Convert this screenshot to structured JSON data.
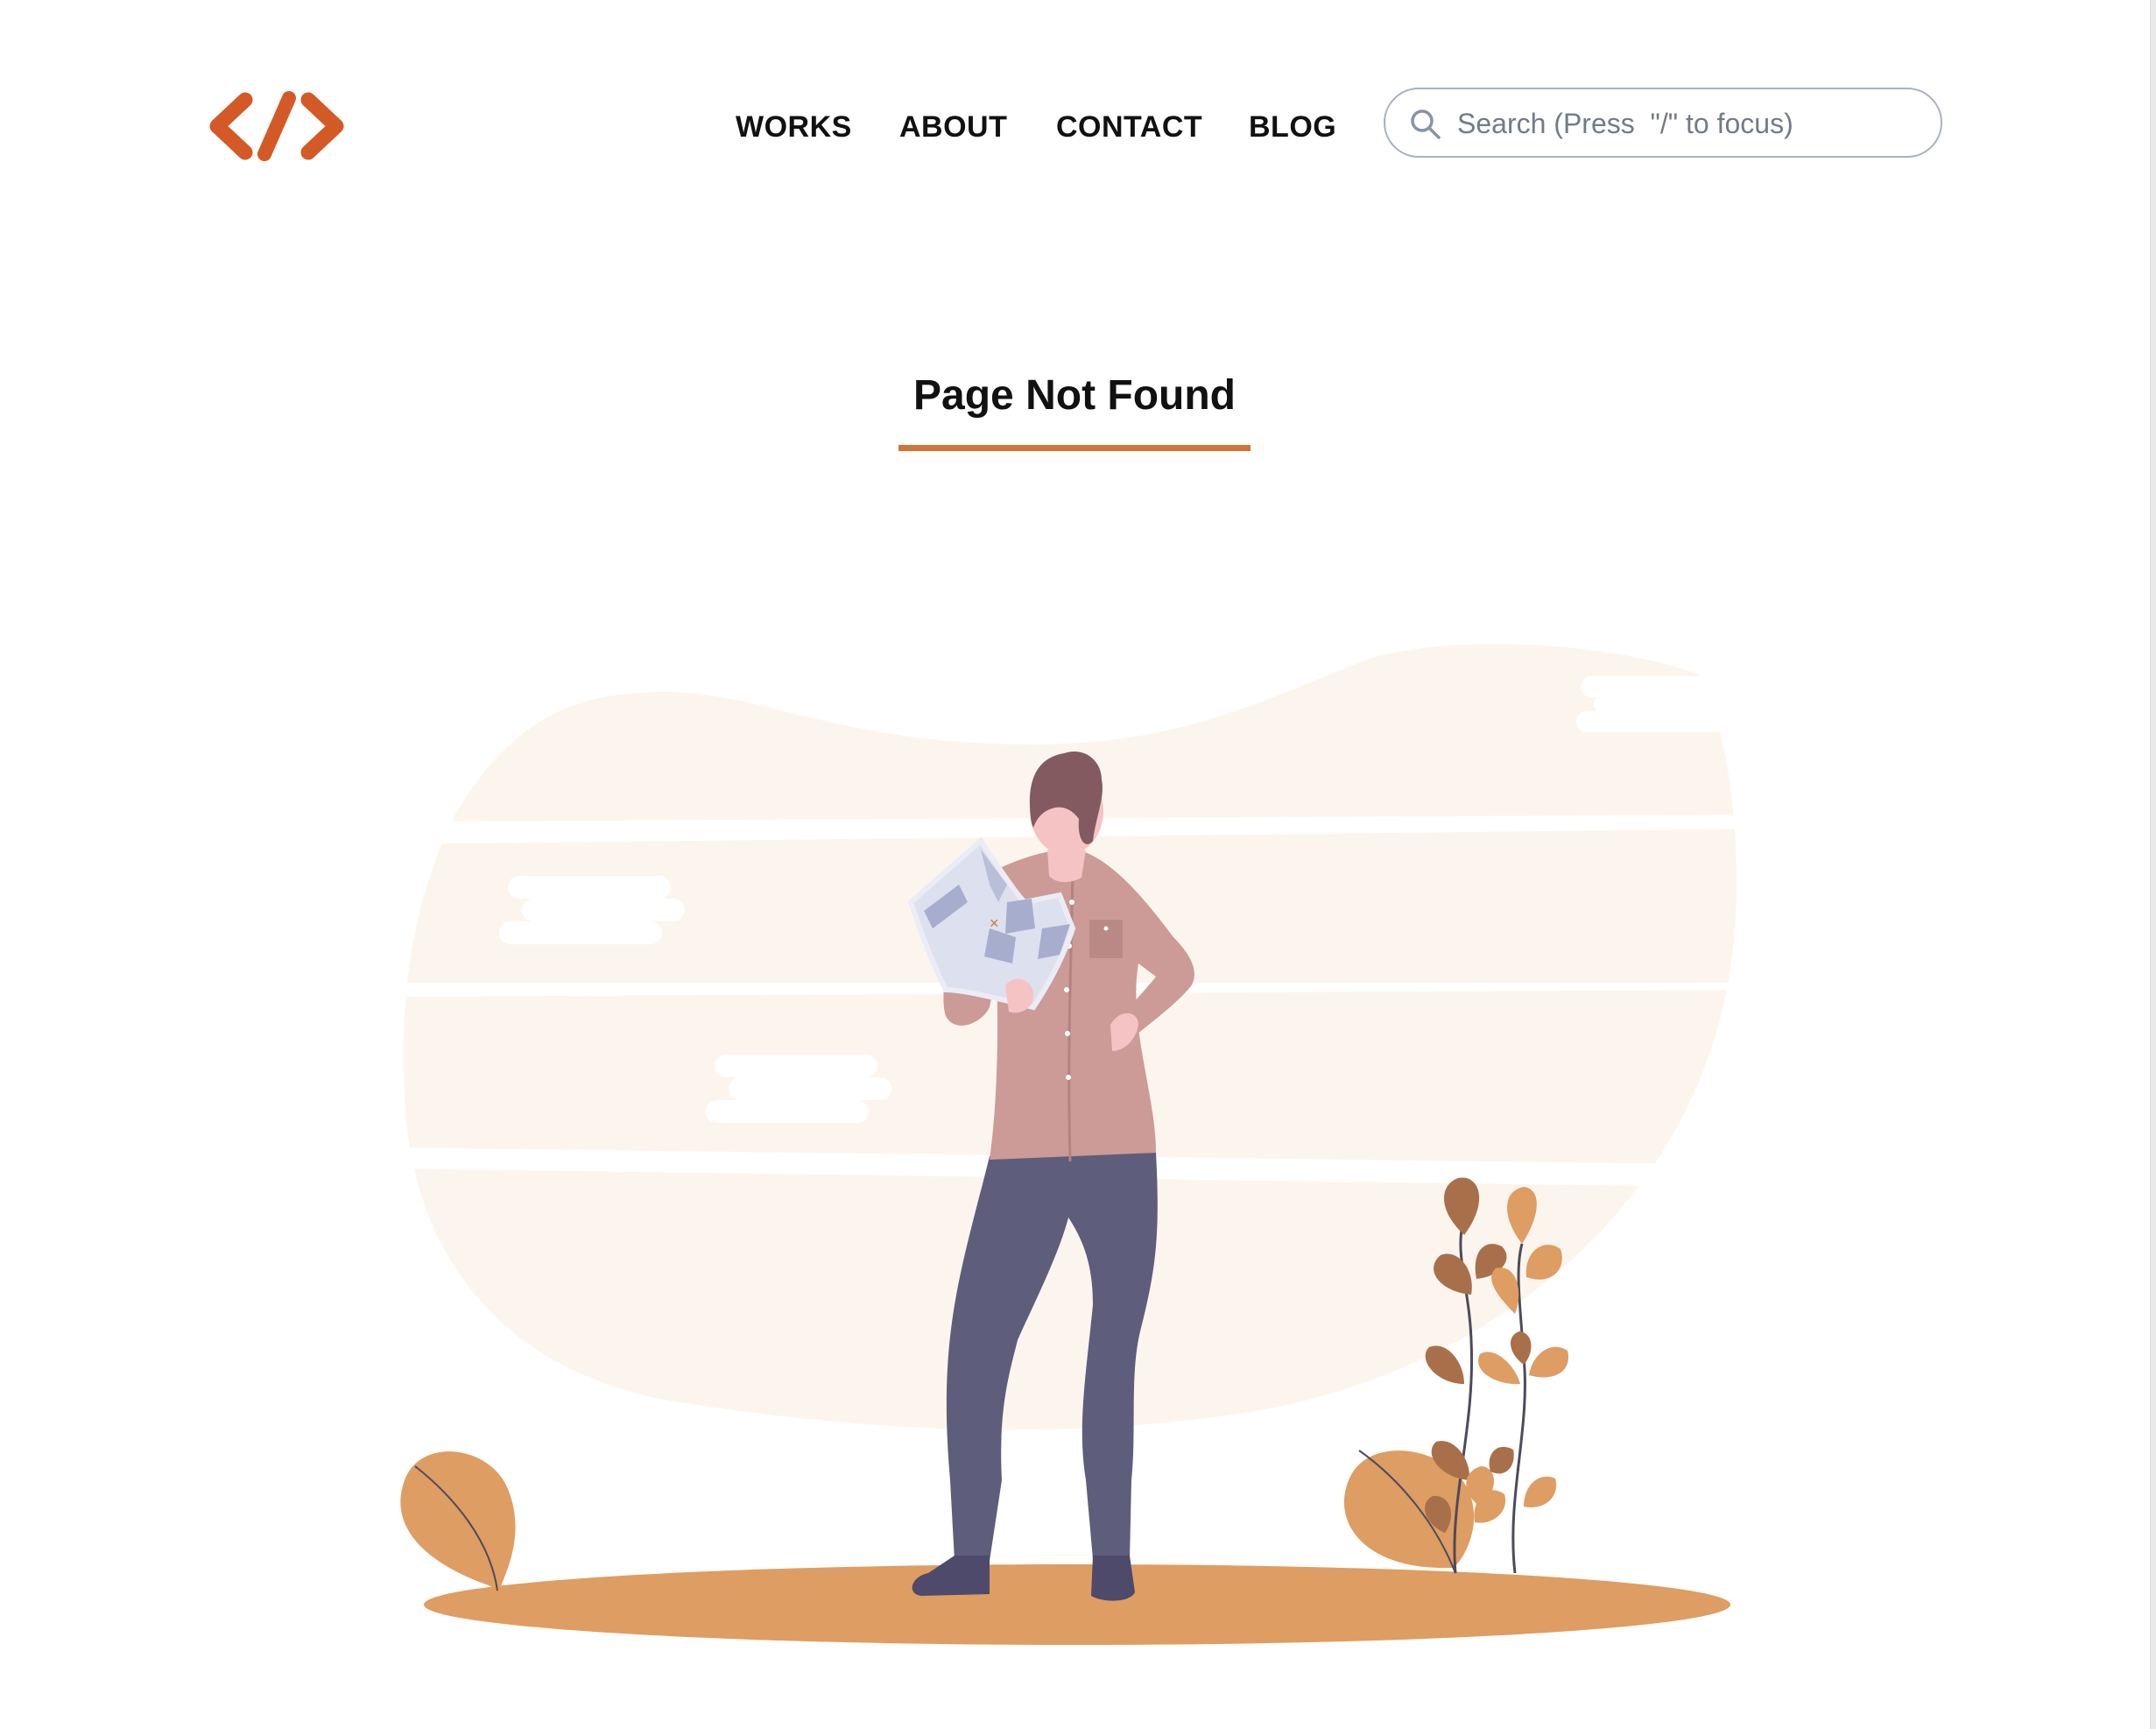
{
  "header": {
    "logo_label": "</>",
    "nav": [
      {
        "label": "WORKS"
      },
      {
        "label": "ABOUT"
      },
      {
        "label": "CONTACT"
      },
      {
        "label": "BLOG"
      }
    ],
    "search": {
      "placeholder": "Search (Press  \"/\" to focus)",
      "value": "",
      "icon": "search-icon"
    }
  },
  "main": {
    "title": "Page Not Found"
  },
  "colors": {
    "brand": "#d35a27",
    "accent_underline": "#d2733a",
    "ground": "#de9d62",
    "background_blob": "#fcf5ee",
    "shirt": "#cc9b97",
    "pants": "#5e5d7c",
    "hair": "#825a60",
    "skin": "#f6c3c4",
    "leaf_dark": "#a8704a"
  }
}
